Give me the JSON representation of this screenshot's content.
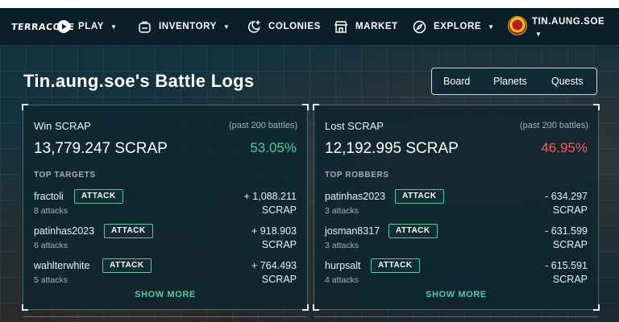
{
  "nav": {
    "logo": "TERRACORE",
    "items": [
      {
        "label": "PLAY",
        "icon": "play-circle-icon",
        "has_caret": true
      },
      {
        "label": "INVENTORY",
        "icon": "backpack-icon",
        "has_caret": true
      },
      {
        "label": "COLONIES",
        "icon": "moon-plus-icon",
        "has_caret": false
      },
      {
        "label": "MARKET",
        "icon": "store-icon",
        "has_caret": false
      },
      {
        "label": "EXPLORE",
        "icon": "compass-icon",
        "has_caret": true
      }
    ],
    "caret": "▼",
    "user": {
      "name": "TIN.AUNG.SOE",
      "avatar": "avatar-icon"
    }
  },
  "page": {
    "title": "Tin.aung.soe's Battle Logs",
    "tabs": [
      "Board",
      "Planets",
      "Quests"
    ]
  },
  "win": {
    "heading": "Win SCRAP",
    "note": "(past 200 battles)",
    "total": "13,779.247 SCRAP",
    "percent": "53.05%",
    "section": "TOP TARGETS",
    "rows": [
      {
        "name": "fractoli",
        "action": "ATTACK",
        "count": "8 attacks",
        "amount": "+ 1,088.211",
        "unit": "SCRAP"
      },
      {
        "name": "patinhas2023",
        "action": "ATTACK",
        "count": "6 attacks",
        "amount": "+ 918.903",
        "unit": "SCRAP"
      },
      {
        "name": "wahlterwhite",
        "action": "ATTACK",
        "count": "5 attacks",
        "amount": "+ 764.493",
        "unit": "SCRAP"
      }
    ],
    "show_more": "SHOW MORE"
  },
  "lost": {
    "heading": "Lost SCRAP",
    "note": "(past 200 battles)",
    "total": "12,192.995 SCRAP",
    "percent": "46.95%",
    "section": "TOP ROBBERS",
    "rows": [
      {
        "name": "patinhas2023",
        "action": "ATTACK",
        "count": "3 attacks",
        "amount": "- 634.297",
        "unit": "SCRAP"
      },
      {
        "name": "josman8317",
        "action": "ATTACK",
        "count": "3 attacks",
        "amount": "- 631.599",
        "unit": "SCRAP"
      },
      {
        "name": "hurpsalt",
        "action": "ATTACK",
        "count": "4 attacks",
        "amount": "- 615.591",
        "unit": "SCRAP"
      }
    ],
    "show_more": "SHOW MORE"
  },
  "colors": {
    "accent": "#56c8a0",
    "win": "#4ecb9d",
    "loss": "#f25f5c",
    "nav_bg": "#0b1f29"
  }
}
